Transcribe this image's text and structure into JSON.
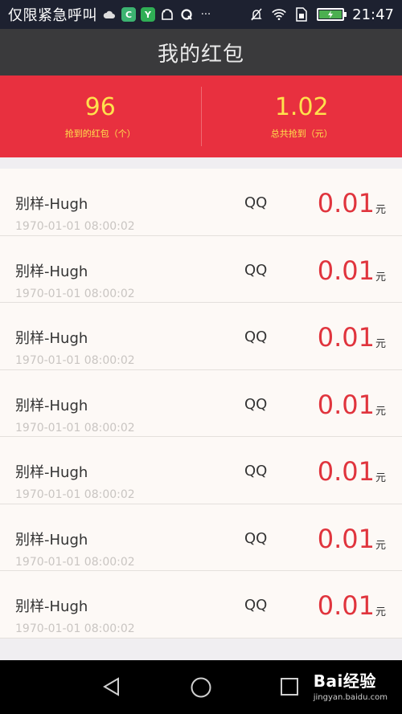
{
  "status_bar": {
    "emergency_text": "仅限紧急呼叫",
    "icons": [
      "cloud-icon",
      "app-c-icon",
      "app-y-icon",
      "android-icon",
      "q-icon",
      "more-dots-icon"
    ],
    "right_icons": [
      "mute-icon",
      "wifi-icon",
      "sim-icon",
      "battery-icon"
    ],
    "time": "21:47",
    "app_c": "C",
    "app_y": "Y",
    "dots": "···"
  },
  "header": {
    "title": "我的红包"
  },
  "summary": {
    "count_value": "96",
    "count_caption": "抢到的红包（个）",
    "total_value": "1.02",
    "total_caption": "总共抢到（元）"
  },
  "list": {
    "items": [
      {
        "name": "别样-Hugh",
        "time": "1970-01-01 08:00:02",
        "source": "QQ",
        "amount": "0.01",
        "unit": "元"
      },
      {
        "name": "别样-Hugh",
        "time": "1970-01-01 08:00:02",
        "source": "QQ",
        "amount": "0.01",
        "unit": "元"
      },
      {
        "name": "别样-Hugh",
        "time": "1970-01-01 08:00:02",
        "source": "QQ",
        "amount": "0.01",
        "unit": "元"
      },
      {
        "name": "别样-Hugh",
        "time": "1970-01-01 08:00:02",
        "source": "QQ",
        "amount": "0.01",
        "unit": "元"
      },
      {
        "name": "别样-Hugh",
        "time": "1970-01-01 08:00:02",
        "source": "QQ",
        "amount": "0.01",
        "unit": "元"
      },
      {
        "name": "别样-Hugh",
        "time": "1970-01-01 08:00:02",
        "source": "QQ",
        "amount": "0.01",
        "unit": "元"
      },
      {
        "name": "别样-Hugh",
        "time": "1970-01-01 08:00:02",
        "source": "QQ",
        "amount": "0.01",
        "unit": "元"
      }
    ]
  },
  "nav": {
    "buttons": [
      "back-triangle-icon",
      "home-circle-icon",
      "recents-square-icon"
    ],
    "watermark_brand": "Bai经验",
    "watermark_sub": "jingyan.baidu.com"
  },
  "colors": {
    "header_bg": "#3a3a3c",
    "summary_bg": "#e8303f",
    "summary_text": "#ffe14d",
    "amount": "#e0343d"
  }
}
